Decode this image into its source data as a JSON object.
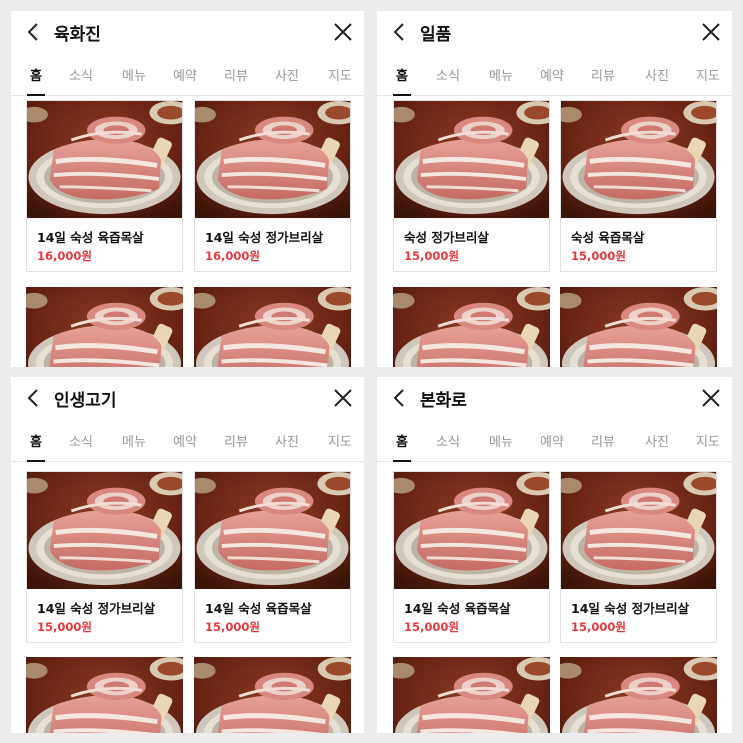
{
  "colors": {
    "price": "#e8383d",
    "active_tab": "#111111",
    "inactive_tab": "#999999"
  },
  "icons": {
    "back": "chevron-left-icon",
    "close": "close-icon"
  },
  "panels": [
    {
      "title": "육화진",
      "tabs": [
        "홈",
        "소식",
        "메뉴",
        "예약",
        "리뷰",
        "사진",
        "지도"
      ],
      "active_tab": "홈",
      "items": [
        {
          "name": "14일 숙성 육즙목살",
          "price": "16,000원"
        },
        {
          "name": "14일 숙성 정가브리살",
          "price": "16,000원"
        }
      ]
    },
    {
      "title": "일품",
      "tabs": [
        "홈",
        "소식",
        "메뉴",
        "예약",
        "리뷰",
        "사진",
        "지도"
      ],
      "active_tab": "홈",
      "items": [
        {
          "name": "숙성 정가브리살",
          "price": "15,000원"
        },
        {
          "name": "숙성 육즙목살",
          "price": "15,000원"
        }
      ]
    },
    {
      "title": "인생고기",
      "tabs": [
        "홈",
        "소식",
        "메뉴",
        "예약",
        "리뷰",
        "사진",
        "지도"
      ],
      "active_tab": "홈",
      "items": [
        {
          "name": "14일 숙성 정가브리살",
          "price": "15,000원"
        },
        {
          "name": "14일 숙성 육즙목살",
          "price": "15,000원"
        }
      ]
    },
    {
      "title": "본화로",
      "tabs": [
        "홈",
        "소식",
        "메뉴",
        "예약",
        "리뷰",
        "사진",
        "지도"
      ],
      "active_tab": "홈",
      "items": [
        {
          "name": "14일 숙성 육즙목살",
          "price": "15,000원"
        },
        {
          "name": "14일 숙성 정가브리살",
          "price": "15,000원"
        }
      ]
    }
  ]
}
